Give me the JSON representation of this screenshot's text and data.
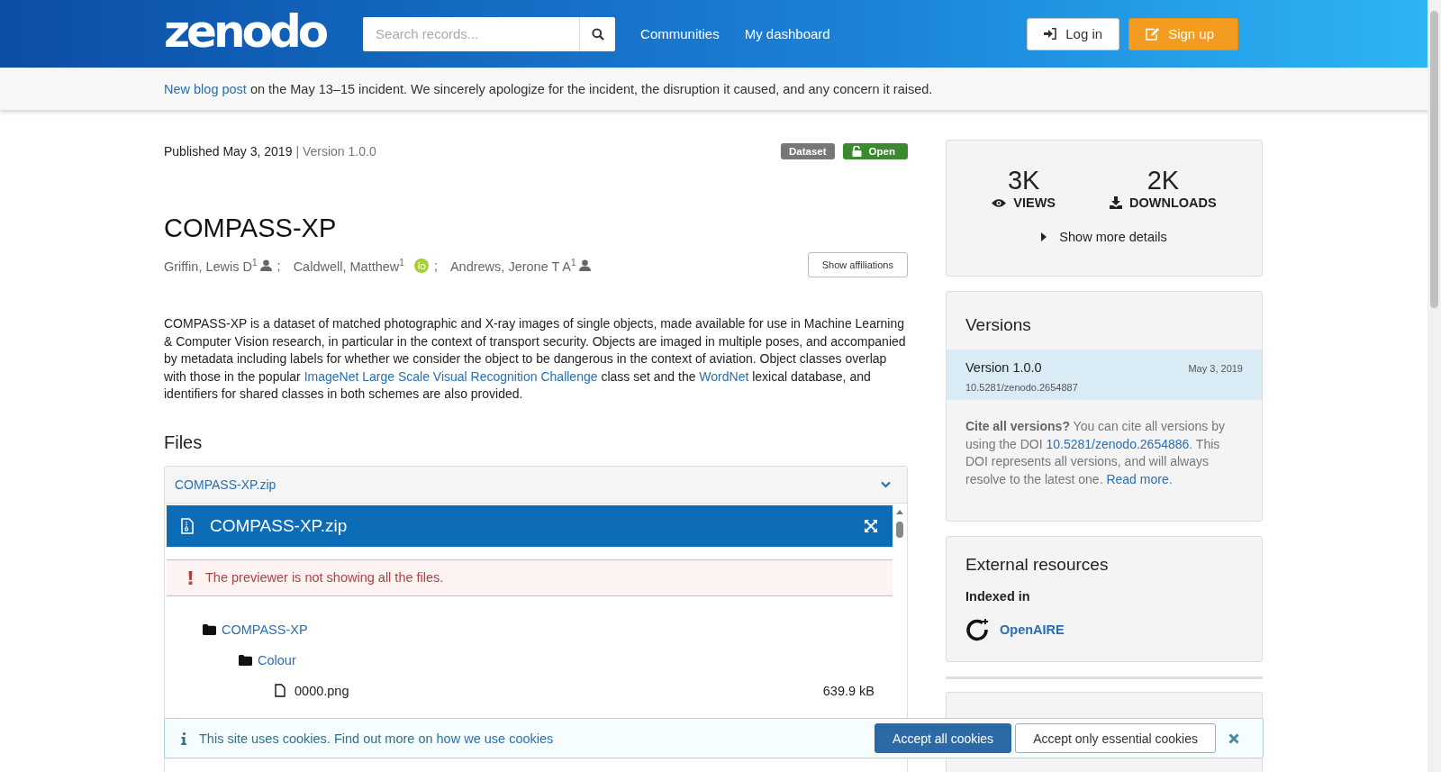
{
  "header": {
    "logo": "zenodo",
    "search": {
      "placeholder": "Search records..."
    },
    "nav": [
      "Communities",
      "My dashboard"
    ],
    "login": "Log in",
    "signup": "Sign up"
  },
  "notice": {
    "link": "New blog post",
    "text": " on the May 13–15 incident. We sincerely apologize for the incident, the disruption it caused, and any concern it raised."
  },
  "record": {
    "published": "Published May 3, 2019",
    "version": "| Version 1.0.0",
    "badges": [
      {
        "label": "Dataset",
        "kind": "type"
      },
      {
        "label": "Open",
        "kind": "access"
      }
    ],
    "title": "COMPASS-XP",
    "authors": [
      {
        "name": "Griffin, Lewis D",
        "sup": "1",
        "kind": "person",
        "separator": ";"
      },
      {
        "name": "Caldwell, Matthew",
        "sup": "1",
        "kind": "orcid",
        "separator": ";"
      },
      {
        "name": "Andrews, Jerone T A",
        "sup": "1",
        "kind": "person"
      }
    ],
    "show_affiliations": "Show affiliations",
    "description": [
      {
        "kind": "text",
        "text": "COMPASS-XP is a dataset of matched photographic and X-ray images of single objects, made available for use in Machine Learning & Computer Vision research, in particular in the context of transport security. Objects are imaged in multiple poses, and accompanied by metadata including labels for whether we consider the object to be dangerous in the context of aviation. Object classes overlap with those in the popular "
      },
      {
        "kind": "link",
        "text": "ImageNet Large Scale Visual Recognition Challenge"
      },
      {
        "kind": "text",
        "text": " class set and the "
      },
      {
        "kind": "link",
        "text": "WordNet"
      },
      {
        "kind": "text",
        "text": " lexical database, and identifiers for shared classes in both schemes are also provided."
      }
    ]
  },
  "files": {
    "heading": "Files",
    "panel_title": "COMPASS-XP.zip",
    "preview_title": "COMPASS-XP.zip",
    "alert": "The previewer is not showing all the files.",
    "tree": [
      {
        "name": "COMPASS-XP",
        "kind": "folder",
        "children": [
          {
            "name": "Colour",
            "kind": "folder",
            "children": [
              {
                "name": "0000.png",
                "kind": "file",
                "size": "639.9 kB"
              }
            ]
          }
        ]
      }
    ]
  },
  "sidebar": {
    "stats": [
      {
        "value": "3K",
        "label": "VIEWS",
        "kind": "views"
      },
      {
        "value": "2K",
        "label": "DOWNLOADS",
        "kind": "downloads"
      }
    ],
    "more_details": "Show more details",
    "versions": {
      "heading": "Versions",
      "items": [
        {
          "version": "Version 1.0.0",
          "date": "May 3, 2019",
          "doi": "10.5281/zenodo.2654887",
          "selected": true
        }
      ],
      "cite": [
        {
          "kind": "bold",
          "text": "Cite all versions?"
        },
        {
          "kind": "text",
          "text": " You can cite all versions by using the DOI "
        },
        {
          "kind": "link",
          "text": "10.5281/zenodo.2654886"
        },
        {
          "kind": "text",
          "text": ". This DOI represents all versions, and will always resolve to the latest one. "
        },
        {
          "kind": "link",
          "text": "Read more"
        },
        {
          "kind": "text",
          "text": "."
        }
      ]
    },
    "external": {
      "heading": "External resources",
      "subheading": "Indexed in",
      "items": [
        "OpenAIRE"
      ]
    }
  },
  "cookies": {
    "text": "This site uses cookies. Find out more on ",
    "link": "how we use cookies",
    "accept_all": "Accept all cookies",
    "accept_essential": "Accept only essential cookies"
  }
}
